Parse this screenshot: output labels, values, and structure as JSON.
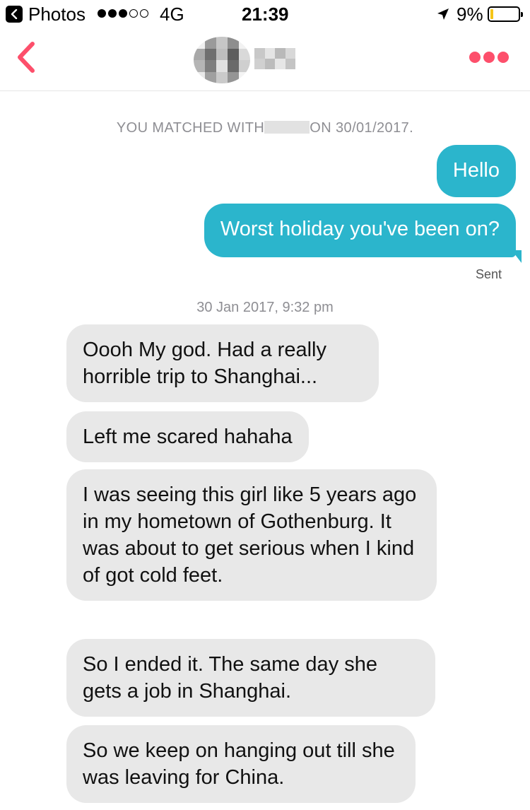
{
  "status_bar": {
    "back_app": "Photos",
    "carrier_signal": "●●●○○",
    "network": "4G",
    "time": "21:39",
    "battery": "9%",
    "battery_level": 0.09,
    "icons": [
      "back-chevron-icon",
      "signal-dots-icon",
      "location-arrow-icon",
      "battery-icon"
    ]
  },
  "nav": {
    "back_icon": "chevron-left-icon",
    "more_icon": "ellipsis-icon",
    "accent": "#fd4f6b"
  },
  "chat": {
    "match_prefix": "YOU MATCHED WITH",
    "match_suffix": "ON 30/01/2017.",
    "sent_label": "Sent",
    "timestamp": "30 Jan 2017, 9:32 pm",
    "outgoing": [
      "Hello",
      "Worst holiday you've been on?"
    ],
    "incoming": [
      "Oooh My god. Had a really horrible trip to Shanghai...",
      "Left me scared hahaha",
      "I was seeing this girl like 5 years ago in my hometown of Gothenburg. It was about to get serious when I kind of got cold feet.",
      "So I ended it. The same day she gets a job in Shanghai.",
      "So we keep on hanging out till she was leaving for China."
    ],
    "colors": {
      "outgoing_bg": "#2bb5cc",
      "incoming_bg": "#e8e8e8"
    }
  }
}
